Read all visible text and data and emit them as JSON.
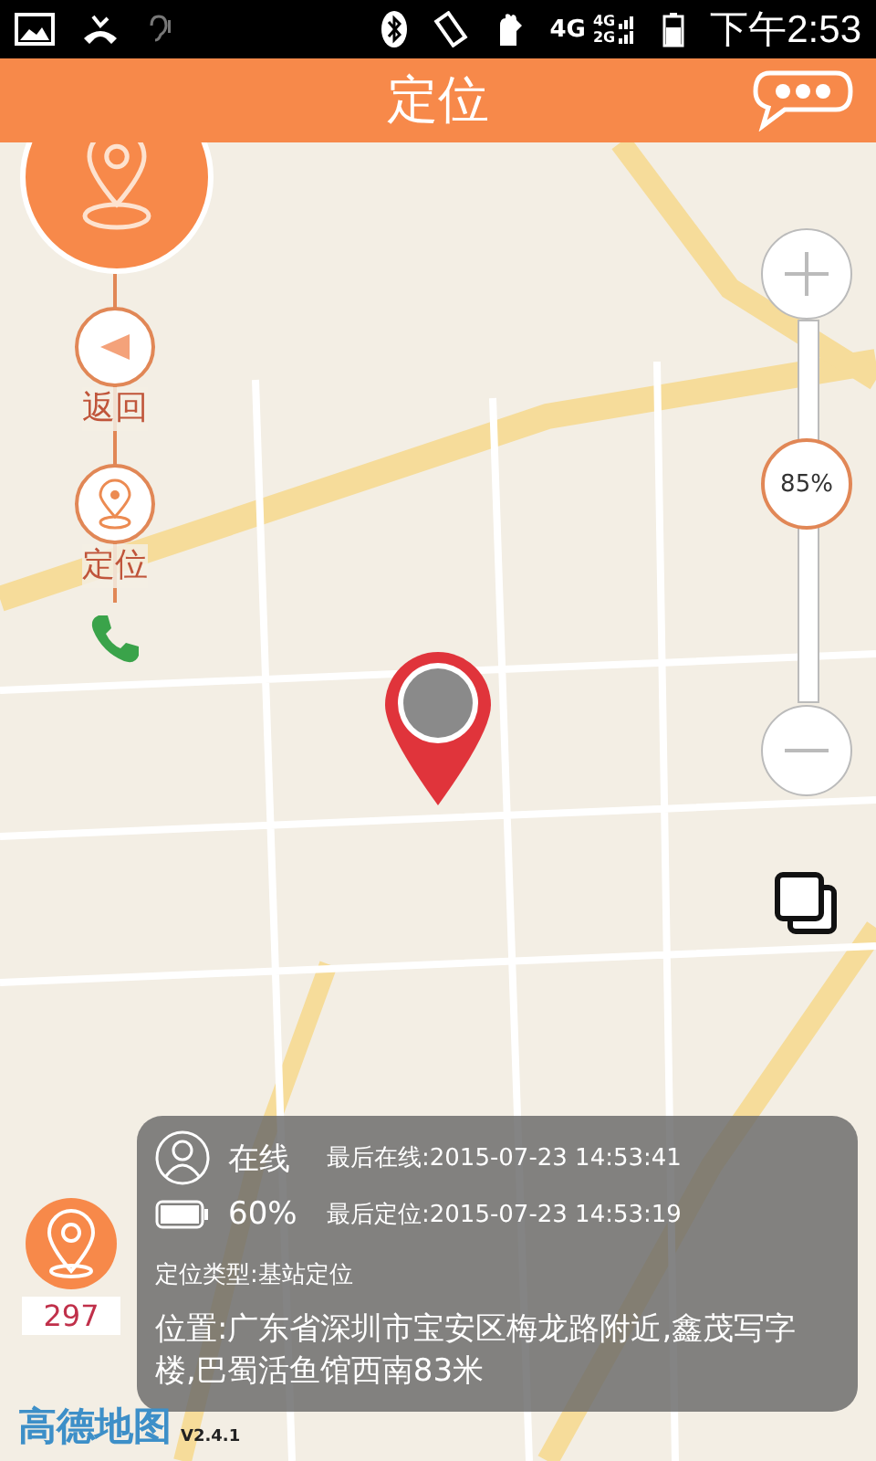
{
  "status_bar": {
    "network_main": "4G",
    "network_top": "4G",
    "network_bottom": "2G",
    "time": "下午2:53"
  },
  "header": {
    "title": "定位"
  },
  "side_buttons": [
    {
      "kind": "back",
      "label": "返回"
    },
    {
      "kind": "locate",
      "label": "定位"
    }
  ],
  "zoom": {
    "reading": "85%",
    "level": 0.57
  },
  "info": {
    "status": "在线",
    "last_online": "最后在线:2015-07-23 14:53:41",
    "battery": "60%",
    "last_located": "最后定位:2015-07-23 14:53:19",
    "locate_type": "定位类型:基站定位",
    "address": "位置:广东省深圳市宝安区梅龙路附近,鑫茂写字楼,巴蜀活鱼馆西南83米"
  },
  "counter": "297",
  "map_logo": "高德地图",
  "version": "V2.4.1"
}
